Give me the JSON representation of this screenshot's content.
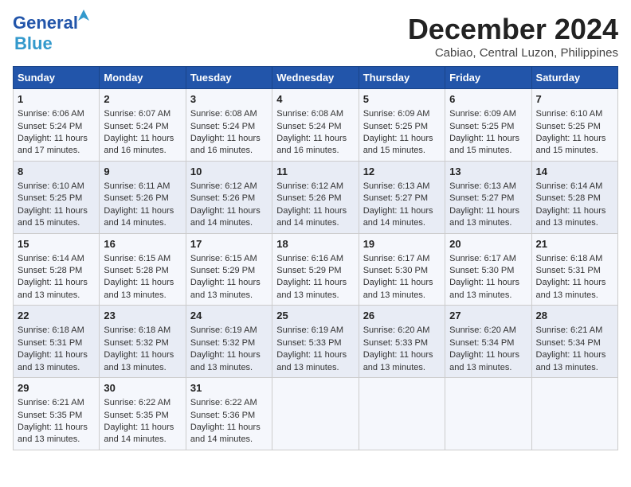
{
  "logo": {
    "line1": "General",
    "line2": "Blue",
    "bird": "▲"
  },
  "title": "December 2024",
  "location": "Cabiao, Central Luzon, Philippines",
  "days_of_week": [
    "Sunday",
    "Monday",
    "Tuesday",
    "Wednesday",
    "Thursday",
    "Friday",
    "Saturday"
  ],
  "weeks": [
    [
      {
        "day": 1,
        "sunrise": "6:06 AM",
        "sunset": "5:24 PM",
        "daylight": "11 hours and 17 minutes."
      },
      {
        "day": 2,
        "sunrise": "6:07 AM",
        "sunset": "5:24 PM",
        "daylight": "11 hours and 16 minutes."
      },
      {
        "day": 3,
        "sunrise": "6:08 AM",
        "sunset": "5:24 PM",
        "daylight": "11 hours and 16 minutes."
      },
      {
        "day": 4,
        "sunrise": "6:08 AM",
        "sunset": "5:24 PM",
        "daylight": "11 hours and 16 minutes."
      },
      {
        "day": 5,
        "sunrise": "6:09 AM",
        "sunset": "5:25 PM",
        "daylight": "11 hours and 15 minutes."
      },
      {
        "day": 6,
        "sunrise": "6:09 AM",
        "sunset": "5:25 PM",
        "daylight": "11 hours and 15 minutes."
      },
      {
        "day": 7,
        "sunrise": "6:10 AM",
        "sunset": "5:25 PM",
        "daylight": "11 hours and 15 minutes."
      }
    ],
    [
      {
        "day": 8,
        "sunrise": "6:10 AM",
        "sunset": "5:25 PM",
        "daylight": "11 hours and 15 minutes."
      },
      {
        "day": 9,
        "sunrise": "6:11 AM",
        "sunset": "5:26 PM",
        "daylight": "11 hours and 14 minutes."
      },
      {
        "day": 10,
        "sunrise": "6:12 AM",
        "sunset": "5:26 PM",
        "daylight": "11 hours and 14 minutes."
      },
      {
        "day": 11,
        "sunrise": "6:12 AM",
        "sunset": "5:26 PM",
        "daylight": "11 hours and 14 minutes."
      },
      {
        "day": 12,
        "sunrise": "6:13 AM",
        "sunset": "5:27 PM",
        "daylight": "11 hours and 14 minutes."
      },
      {
        "day": 13,
        "sunrise": "6:13 AM",
        "sunset": "5:27 PM",
        "daylight": "11 hours and 13 minutes."
      },
      {
        "day": 14,
        "sunrise": "6:14 AM",
        "sunset": "5:28 PM",
        "daylight": "11 hours and 13 minutes."
      }
    ],
    [
      {
        "day": 15,
        "sunrise": "6:14 AM",
        "sunset": "5:28 PM",
        "daylight": "11 hours and 13 minutes."
      },
      {
        "day": 16,
        "sunrise": "6:15 AM",
        "sunset": "5:28 PM",
        "daylight": "11 hours and 13 minutes."
      },
      {
        "day": 17,
        "sunrise": "6:15 AM",
        "sunset": "5:29 PM",
        "daylight": "11 hours and 13 minutes."
      },
      {
        "day": 18,
        "sunrise": "6:16 AM",
        "sunset": "5:29 PM",
        "daylight": "11 hours and 13 minutes."
      },
      {
        "day": 19,
        "sunrise": "6:17 AM",
        "sunset": "5:30 PM",
        "daylight": "11 hours and 13 minutes."
      },
      {
        "day": 20,
        "sunrise": "6:17 AM",
        "sunset": "5:30 PM",
        "daylight": "11 hours and 13 minutes."
      },
      {
        "day": 21,
        "sunrise": "6:18 AM",
        "sunset": "5:31 PM",
        "daylight": "11 hours and 13 minutes."
      }
    ],
    [
      {
        "day": 22,
        "sunrise": "6:18 AM",
        "sunset": "5:31 PM",
        "daylight": "11 hours and 13 minutes."
      },
      {
        "day": 23,
        "sunrise": "6:18 AM",
        "sunset": "5:32 PM",
        "daylight": "11 hours and 13 minutes."
      },
      {
        "day": 24,
        "sunrise": "6:19 AM",
        "sunset": "5:32 PM",
        "daylight": "11 hours and 13 minutes."
      },
      {
        "day": 25,
        "sunrise": "6:19 AM",
        "sunset": "5:33 PM",
        "daylight": "11 hours and 13 minutes."
      },
      {
        "day": 26,
        "sunrise": "6:20 AM",
        "sunset": "5:33 PM",
        "daylight": "11 hours and 13 minutes."
      },
      {
        "day": 27,
        "sunrise": "6:20 AM",
        "sunset": "5:34 PM",
        "daylight": "11 hours and 13 minutes."
      },
      {
        "day": 28,
        "sunrise": "6:21 AM",
        "sunset": "5:34 PM",
        "daylight": "11 hours and 13 minutes."
      }
    ],
    [
      {
        "day": 29,
        "sunrise": "6:21 AM",
        "sunset": "5:35 PM",
        "daylight": "11 hours and 13 minutes."
      },
      {
        "day": 30,
        "sunrise": "6:22 AM",
        "sunset": "5:35 PM",
        "daylight": "11 hours and 14 minutes."
      },
      {
        "day": 31,
        "sunrise": "6:22 AM",
        "sunset": "5:36 PM",
        "daylight": "11 hours and 14 minutes."
      },
      null,
      null,
      null,
      null
    ]
  ],
  "labels": {
    "sunrise": "Sunrise:",
    "sunset": "Sunset:",
    "daylight": "Daylight:"
  }
}
